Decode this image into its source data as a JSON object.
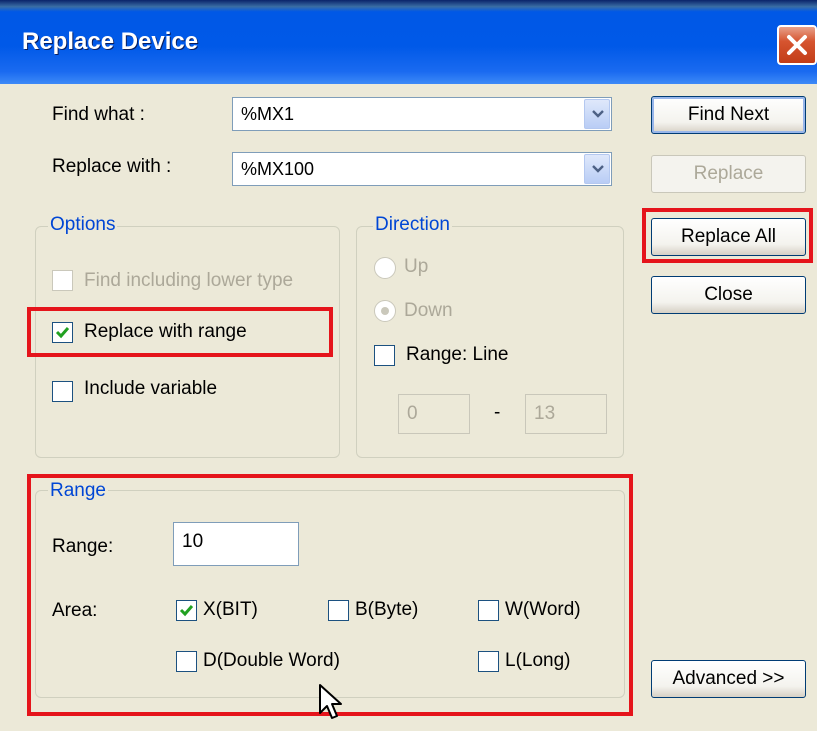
{
  "window": {
    "title": "Replace Device"
  },
  "find": {
    "label": "Find what :",
    "value": "%MX1"
  },
  "replace": {
    "label": "Replace with :",
    "value": "%MX100"
  },
  "buttons": {
    "find_next": "Find Next",
    "replace": "Replace",
    "replace_all": "Replace All",
    "close": "Close",
    "advanced": "Advanced >>"
  },
  "options": {
    "title": "Options",
    "find_lower": {
      "label": "Find including lower type",
      "checked": false,
      "enabled": false
    },
    "replace_range": {
      "label": "Replace with range",
      "checked": true
    },
    "include_variable": {
      "label": "Include variable",
      "checked": false
    }
  },
  "direction": {
    "title": "Direction",
    "up": "Up",
    "down": "Down",
    "range_line": {
      "label": "Range: Line",
      "checked": false
    },
    "line_from": "0",
    "separator": "-",
    "line_to": "13"
  },
  "range": {
    "title": "Range",
    "range_label": "Range:",
    "range_value": "10",
    "area_label": "Area:",
    "areas": [
      {
        "label": "X(BIT)",
        "checked": true
      },
      {
        "label": "B(Byte)",
        "checked": false
      },
      {
        "label": "W(Word)",
        "checked": false
      },
      {
        "label": "D(Double Word)",
        "checked": false
      },
      {
        "label": "L(Long)",
        "checked": false
      }
    ]
  },
  "colors": {
    "highlight": "#e5141b",
    "group_title": "#0046d5",
    "titlebar": "#0058e6"
  }
}
